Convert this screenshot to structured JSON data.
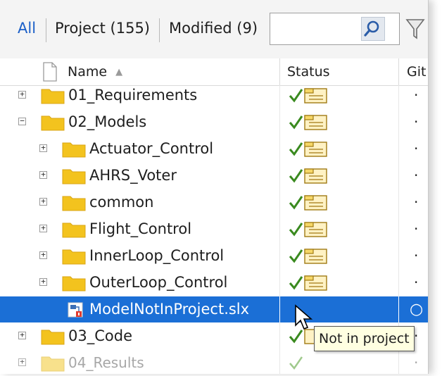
{
  "filters": {
    "all": "All",
    "project": "Project (155)",
    "modified": "Modified (9)",
    "search_placeholder": "",
    "search_icon": "search-icon",
    "filter_icon": "funnel-icon"
  },
  "columns": {
    "name": "Name",
    "sort_indicator": "▲",
    "status": "Status",
    "git": "Git"
  },
  "rows": [
    {
      "name": "01_Requirements",
      "expander": "+",
      "type": "folder",
      "git": "·"
    },
    {
      "name": "02_Models",
      "expander": "−",
      "type": "folder",
      "git": "·"
    },
    {
      "name": "Actuator_Control",
      "expander": "+",
      "type": "folder",
      "git": "·"
    },
    {
      "name": "AHRS_Voter",
      "expander": "+",
      "type": "folder",
      "git": "·"
    },
    {
      "name": "common",
      "expander": "+",
      "type": "folder",
      "git": "·"
    },
    {
      "name": "Flight_Control",
      "expander": "+",
      "type": "folder",
      "git": "·"
    },
    {
      "name": "InnerLoop_Control",
      "expander": "+",
      "type": "folder",
      "git": "·"
    },
    {
      "name": "OuterLoop_Control",
      "expander": "+",
      "type": "folder",
      "git": "·"
    },
    {
      "name": "ModelNotInProject.slx",
      "expander": "",
      "type": "file",
      "git": "○"
    },
    {
      "name": "03_Code",
      "expander": "+",
      "type": "folder",
      "git": "·"
    },
    {
      "name": "04_Results",
      "expander": "+",
      "type": "folder",
      "git": "·"
    }
  ],
  "tooltip": "Not in project",
  "colors": {
    "selection": "#1b6fd6",
    "active_tab": "#1a5fc8",
    "check": "#3a8a1f",
    "folder": "#f3c31e"
  }
}
